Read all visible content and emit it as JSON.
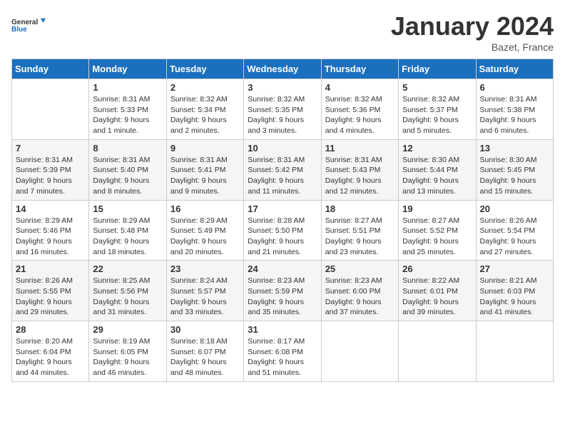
{
  "header": {
    "logo_general": "General",
    "logo_blue": "Blue",
    "month_title": "January 2024",
    "location": "Bazet, France"
  },
  "weekdays": [
    "Sunday",
    "Monday",
    "Tuesday",
    "Wednesday",
    "Thursday",
    "Friday",
    "Saturday"
  ],
  "weeks": [
    [
      {
        "day": "",
        "sunrise": "",
        "sunset": "",
        "daylight": ""
      },
      {
        "day": "1",
        "sunrise": "Sunrise: 8:31 AM",
        "sunset": "Sunset: 5:33 PM",
        "daylight": "Daylight: 9 hours and 1 minute."
      },
      {
        "day": "2",
        "sunrise": "Sunrise: 8:32 AM",
        "sunset": "Sunset: 5:34 PM",
        "daylight": "Daylight: 9 hours and 2 minutes."
      },
      {
        "day": "3",
        "sunrise": "Sunrise: 8:32 AM",
        "sunset": "Sunset: 5:35 PM",
        "daylight": "Daylight: 9 hours and 3 minutes."
      },
      {
        "day": "4",
        "sunrise": "Sunrise: 8:32 AM",
        "sunset": "Sunset: 5:36 PM",
        "daylight": "Daylight: 9 hours and 4 minutes."
      },
      {
        "day": "5",
        "sunrise": "Sunrise: 8:32 AM",
        "sunset": "Sunset: 5:37 PM",
        "daylight": "Daylight: 9 hours and 5 minutes."
      },
      {
        "day": "6",
        "sunrise": "Sunrise: 8:31 AM",
        "sunset": "Sunset: 5:38 PM",
        "daylight": "Daylight: 9 hours and 6 minutes."
      }
    ],
    [
      {
        "day": "7",
        "sunrise": "Sunrise: 8:31 AM",
        "sunset": "Sunset: 5:39 PM",
        "daylight": "Daylight: 9 hours and 7 minutes."
      },
      {
        "day": "8",
        "sunrise": "Sunrise: 8:31 AM",
        "sunset": "Sunset: 5:40 PM",
        "daylight": "Daylight: 9 hours and 8 minutes."
      },
      {
        "day": "9",
        "sunrise": "Sunrise: 8:31 AM",
        "sunset": "Sunset: 5:41 PM",
        "daylight": "Daylight: 9 hours and 9 minutes."
      },
      {
        "day": "10",
        "sunrise": "Sunrise: 8:31 AM",
        "sunset": "Sunset: 5:42 PM",
        "daylight": "Daylight: 9 hours and 11 minutes."
      },
      {
        "day": "11",
        "sunrise": "Sunrise: 8:31 AM",
        "sunset": "Sunset: 5:43 PM",
        "daylight": "Daylight: 9 hours and 12 minutes."
      },
      {
        "day": "12",
        "sunrise": "Sunrise: 8:30 AM",
        "sunset": "Sunset: 5:44 PM",
        "daylight": "Daylight: 9 hours and 13 minutes."
      },
      {
        "day": "13",
        "sunrise": "Sunrise: 8:30 AM",
        "sunset": "Sunset: 5:45 PM",
        "daylight": "Daylight: 9 hours and 15 minutes."
      }
    ],
    [
      {
        "day": "14",
        "sunrise": "Sunrise: 8:29 AM",
        "sunset": "Sunset: 5:46 PM",
        "daylight": "Daylight: 9 hours and 16 minutes."
      },
      {
        "day": "15",
        "sunrise": "Sunrise: 8:29 AM",
        "sunset": "Sunset: 5:48 PM",
        "daylight": "Daylight: 9 hours and 18 minutes."
      },
      {
        "day": "16",
        "sunrise": "Sunrise: 8:29 AM",
        "sunset": "Sunset: 5:49 PM",
        "daylight": "Daylight: 9 hours and 20 minutes."
      },
      {
        "day": "17",
        "sunrise": "Sunrise: 8:28 AM",
        "sunset": "Sunset: 5:50 PM",
        "daylight": "Daylight: 9 hours and 21 minutes."
      },
      {
        "day": "18",
        "sunrise": "Sunrise: 8:27 AM",
        "sunset": "Sunset: 5:51 PM",
        "daylight": "Daylight: 9 hours and 23 minutes."
      },
      {
        "day": "19",
        "sunrise": "Sunrise: 8:27 AM",
        "sunset": "Sunset: 5:52 PM",
        "daylight": "Daylight: 9 hours and 25 minutes."
      },
      {
        "day": "20",
        "sunrise": "Sunrise: 8:26 AM",
        "sunset": "Sunset: 5:54 PM",
        "daylight": "Daylight: 9 hours and 27 minutes."
      }
    ],
    [
      {
        "day": "21",
        "sunrise": "Sunrise: 8:26 AM",
        "sunset": "Sunset: 5:55 PM",
        "daylight": "Daylight: 9 hours and 29 minutes."
      },
      {
        "day": "22",
        "sunrise": "Sunrise: 8:25 AM",
        "sunset": "Sunset: 5:56 PM",
        "daylight": "Daylight: 9 hours and 31 minutes."
      },
      {
        "day": "23",
        "sunrise": "Sunrise: 8:24 AM",
        "sunset": "Sunset: 5:57 PM",
        "daylight": "Daylight: 9 hours and 33 minutes."
      },
      {
        "day": "24",
        "sunrise": "Sunrise: 8:23 AM",
        "sunset": "Sunset: 5:59 PM",
        "daylight": "Daylight: 9 hours and 35 minutes."
      },
      {
        "day": "25",
        "sunrise": "Sunrise: 8:23 AM",
        "sunset": "Sunset: 6:00 PM",
        "daylight": "Daylight: 9 hours and 37 minutes."
      },
      {
        "day": "26",
        "sunrise": "Sunrise: 8:22 AM",
        "sunset": "Sunset: 6:01 PM",
        "daylight": "Daylight: 9 hours and 39 minutes."
      },
      {
        "day": "27",
        "sunrise": "Sunrise: 8:21 AM",
        "sunset": "Sunset: 6:03 PM",
        "daylight": "Daylight: 9 hours and 41 minutes."
      }
    ],
    [
      {
        "day": "28",
        "sunrise": "Sunrise: 8:20 AM",
        "sunset": "Sunset: 6:04 PM",
        "daylight": "Daylight: 9 hours and 44 minutes."
      },
      {
        "day": "29",
        "sunrise": "Sunrise: 8:19 AM",
        "sunset": "Sunset: 6:05 PM",
        "daylight": "Daylight: 9 hours and 46 minutes."
      },
      {
        "day": "30",
        "sunrise": "Sunrise: 8:18 AM",
        "sunset": "Sunset: 6:07 PM",
        "daylight": "Daylight: 9 hours and 48 minutes."
      },
      {
        "day": "31",
        "sunrise": "Sunrise: 8:17 AM",
        "sunset": "Sunset: 6:08 PM",
        "daylight": "Daylight: 9 hours and 51 minutes."
      },
      {
        "day": "",
        "sunrise": "",
        "sunset": "",
        "daylight": ""
      },
      {
        "day": "",
        "sunrise": "",
        "sunset": "",
        "daylight": ""
      },
      {
        "day": "",
        "sunrise": "",
        "sunset": "",
        "daylight": ""
      }
    ]
  ]
}
